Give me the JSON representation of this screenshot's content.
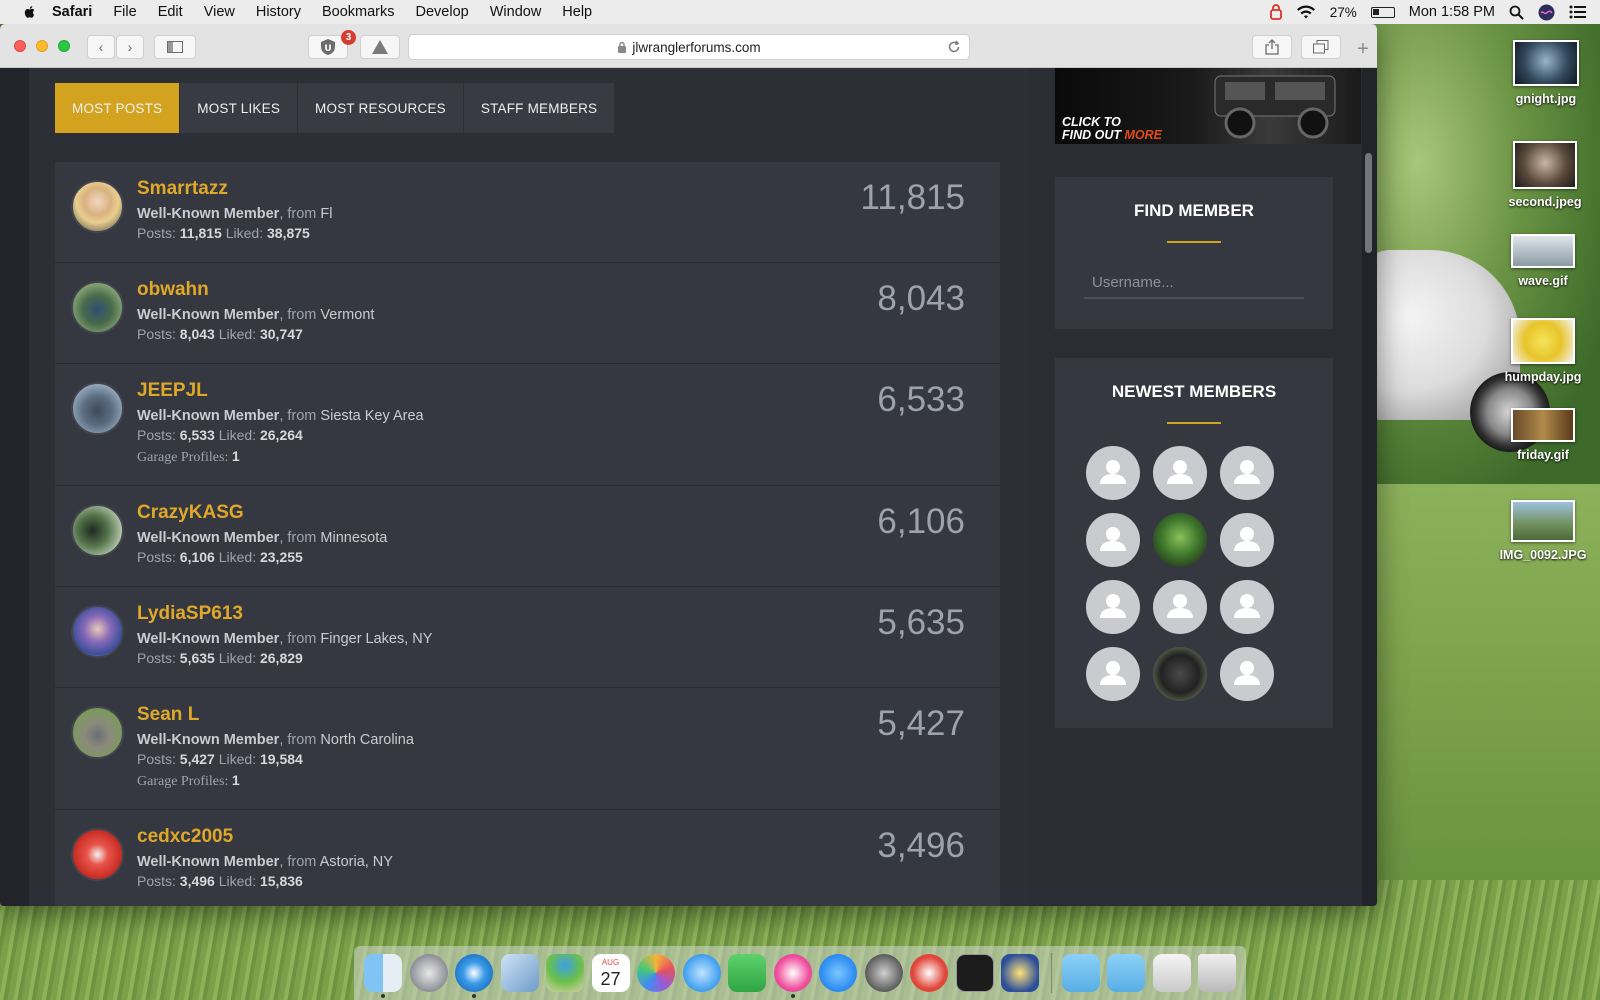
{
  "menubar": {
    "app": "Safari",
    "items": [
      "File",
      "Edit",
      "View",
      "History",
      "Bookmarks",
      "Develop",
      "Window",
      "Help"
    ],
    "battery": "27%",
    "clock": "Mon 1:58 PM"
  },
  "browser": {
    "url": "jlwranglerforums.com",
    "extension_badge": "3"
  },
  "tabs": [
    "MOST POSTS",
    "MOST LIKES",
    "MOST RESOURCES",
    "STAFF MEMBERS"
  ],
  "members": [
    {
      "name": "Smarrtazz",
      "role": "Well-Known Member",
      "from_label": ", from",
      "location": "Fl",
      "posts": "11,815",
      "liked": "38,875",
      "count": "11,815"
    },
    {
      "name": "obwahn",
      "role": "Well-Known Member",
      "from_label": ", from",
      "location": "Vermont",
      "posts": "8,043",
      "liked": "30,747",
      "count": "8,043"
    },
    {
      "name": "JEEPJL",
      "role": "Well-Known Member",
      "from_label": ", from",
      "location": "Siesta Key Area",
      "posts": "6,533",
      "liked": "26,264",
      "garage": "1",
      "count": "6,533"
    },
    {
      "name": "CrazyKASG",
      "role": "Well-Known Member",
      "from_label": ", from",
      "location": "Minnesota",
      "posts": "6,106",
      "liked": "23,255",
      "count": "6,106"
    },
    {
      "name": "LydiaSP613",
      "role": "Well-Known Member",
      "from_label": ", from",
      "location": "Finger Lakes, NY",
      "posts": "5,635",
      "liked": "26,829",
      "count": "5,635"
    },
    {
      "name": "Sean L",
      "role": "Well-Known Member",
      "from_label": ", from",
      "location": "North Carolina",
      "posts": "5,427",
      "liked": "19,584",
      "garage": "1",
      "count": "5,427"
    },
    {
      "name": "cedxc2005",
      "role": "Well-Known Member",
      "from_label": ", from",
      "location": "Astoria, NY",
      "posts": "3,496",
      "liked": "15,836",
      "count": "3,496"
    }
  ],
  "labels": {
    "posts": "Posts:",
    "liked": "Liked:",
    "garage": "Garage Profiles:"
  },
  "ad": {
    "line1": "CLICK TO",
    "line2": "FIND OUT",
    "more": "MORE"
  },
  "find_member": {
    "title": "FIND MEMBER",
    "placeholder": "Username..."
  },
  "newest_members": {
    "title": "NEWEST MEMBERS"
  },
  "desktop_icons": [
    "gnight.jpg",
    "second.jpeg",
    "wave.gif",
    "humpday.jpg",
    "friday.gif",
    "IMG_0092.JPG"
  ],
  "dock_calendar": {
    "month": "AUG",
    "day": "27"
  },
  "colors": {
    "accent": "#d3a21f",
    "username": "#e0a829",
    "panel": "#353840",
    "page": "#2c2f36"
  }
}
